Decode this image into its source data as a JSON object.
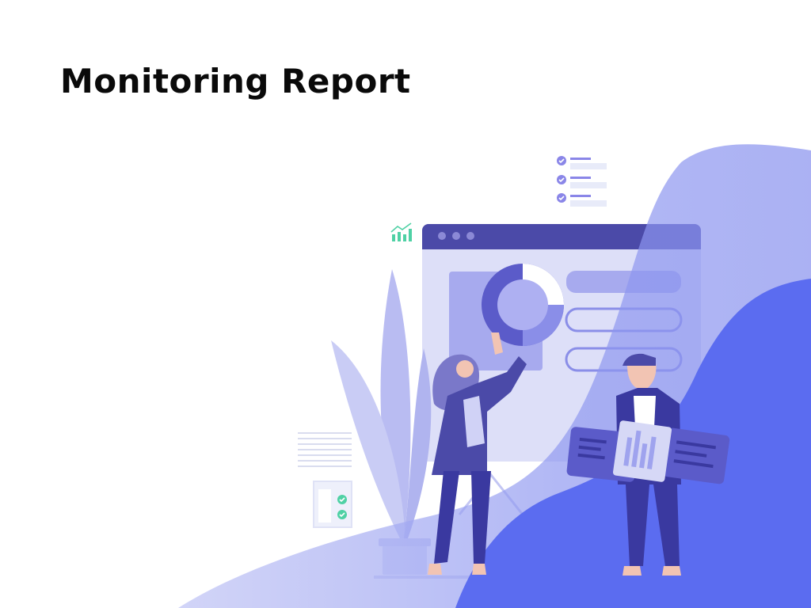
{
  "slide": {
    "title": "Monitoring Report"
  },
  "colors": {
    "accent": "#5b6cf0",
    "accent_light": "#a3aaf2",
    "accent_dark": "#4b4aa8",
    "check_green": "#4fd1a5",
    "check_purple": "#8a86e8"
  },
  "illustration": {
    "icons": [
      "bar-chart-icon",
      "checklist-icon",
      "donut-chart-icon",
      "checkbox-icon"
    ],
    "figures": [
      "woman-holding-chart",
      "man-holding-board",
      "plant"
    ]
  }
}
